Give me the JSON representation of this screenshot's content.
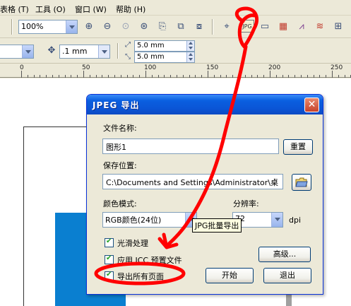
{
  "menubar": {
    "items": [
      {
        "label": "表格(T)",
        "visible_part": "表格 (T)"
      },
      {
        "label": "工具(O)",
        "visible_part": "工具 (O)"
      },
      {
        "label": "窗口(W)",
        "visible_part": "窗口 (W)"
      },
      {
        "label": "帮助(H)",
        "visible_part": "帮助 (H)"
      }
    ]
  },
  "toolbar": {
    "zoom_value": "100%",
    "outline_width": ".1 mm",
    "duplicate_x": "5.0 mm",
    "duplicate_y": "5.0 mm"
  },
  "ruler": {
    "labels": [
      "0",
      "50",
      "100",
      "150",
      "200",
      "250"
    ]
  },
  "dialog": {
    "title": "JPEG 导出",
    "close_glyph": "✕",
    "filename_label": "文件名称:",
    "filename_value": "图形1",
    "reset_button": "重置",
    "save_location_label": "保存位置:",
    "save_location_value": "C:\\Documents and Settings\\Administrator\\桌",
    "color_mode_label": "颜色模式:",
    "color_mode_value": "RGB颜色(24位)",
    "resolution_label": "分辨率:",
    "resolution_value": "72",
    "resolution_unit": "dpi",
    "smoothing_label": "光滑处理",
    "icc_label": "应用 ICC 预置文件",
    "export_all_label": "导出所有页面",
    "advanced_button": "高级...",
    "start_button": "开始",
    "exit_button": "退出"
  },
  "tooltip": {
    "text": "JPG批量导出"
  },
  "colors": {
    "titlebar": "#0a55d6",
    "annotation_red": "#ff0000",
    "canvas_blue": "#0a7fd0"
  }
}
